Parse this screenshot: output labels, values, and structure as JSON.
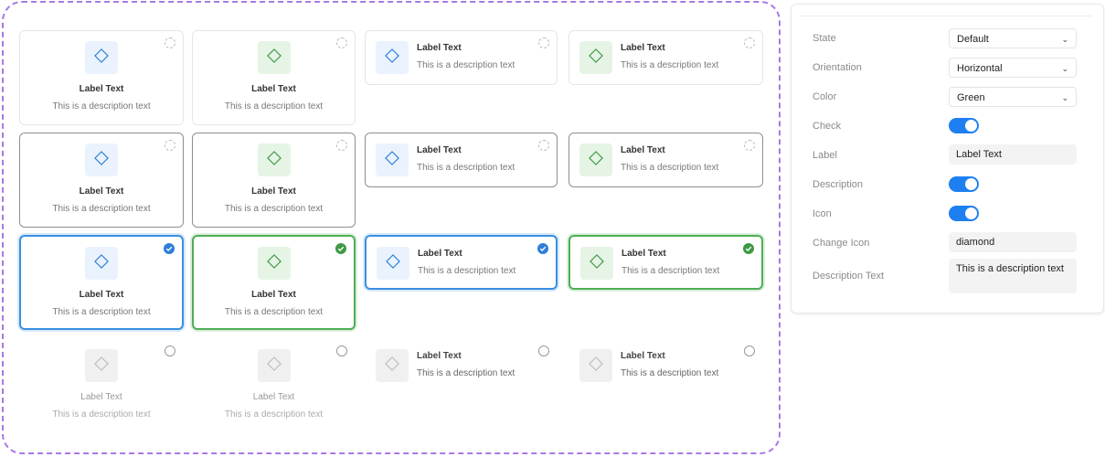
{
  "colors": {
    "blue": "#2c7fd9",
    "green": "#3f9a45",
    "purple_dash": "#a77ae6",
    "toggle_on": "#1e7ff0"
  },
  "icons": {
    "card_icon": "diamond-icon",
    "check_icon": "checkmark-icon",
    "select_icon": "chevron-down-icon"
  },
  "card": {
    "label": "Label Text",
    "description": "This is a description text"
  },
  "panel": {
    "state": {
      "label": "State",
      "value": "Default"
    },
    "orientation": {
      "label": "Orientation",
      "value": "Horizontal"
    },
    "color": {
      "label": "Color",
      "value": "Green"
    },
    "check": {
      "label": "Check",
      "on": true
    },
    "label_field": {
      "label": "Label",
      "value": "Label Text"
    },
    "description": {
      "label": "Description",
      "on": true
    },
    "icon": {
      "label": "Icon",
      "on": true
    },
    "change_icon": {
      "label": "Change Icon",
      "value": "diamond"
    },
    "description_text": {
      "label": "Description Text",
      "value": "This is a description text"
    }
  }
}
